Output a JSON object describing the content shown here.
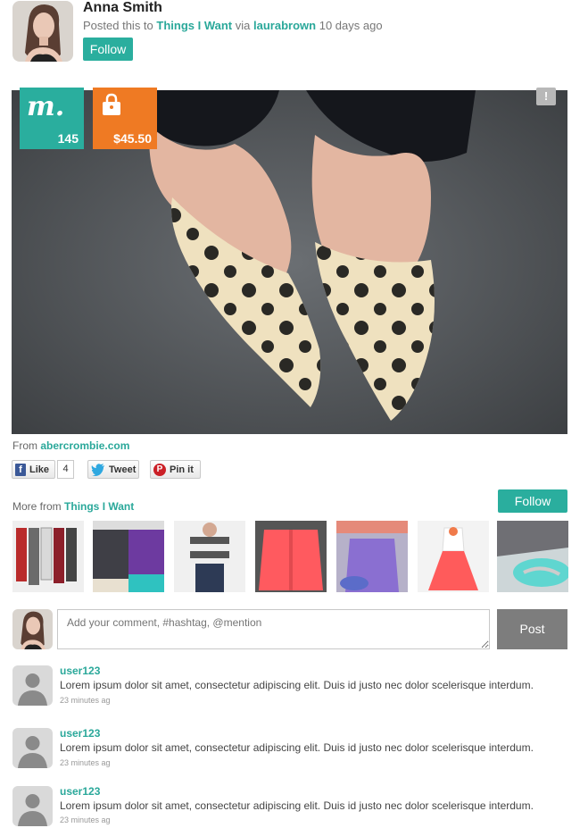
{
  "header": {
    "author_name": "Anna Smith",
    "posted_prefix": "Posted this to",
    "collection": "Things I Want",
    "via_word": "via",
    "via_user": "laurabrown",
    "time_ago": "10 days ago",
    "follow_label": "Follow"
  },
  "photo": {
    "badge_m_glyph": "m.",
    "badge_m_count": "145",
    "badge_price": "$45.50",
    "report_glyph": "!",
    "icon_names": [
      "m-logo-icon",
      "shopping-bag-icon",
      "report-flag-icon"
    ]
  },
  "source": {
    "from_label": "From",
    "domain": "abercrombie.com"
  },
  "share": {
    "like_label": "Like",
    "like_count": "4",
    "tweet_label": "Tweet",
    "pin_label": "Pin it",
    "fb_glyph": "f",
    "tw_glyph": "🐦",
    "pin_glyph": "P"
  },
  "more": {
    "prefix": "More from",
    "collection": "Things I Want",
    "follow_label": "Follow"
  },
  "composer": {
    "placeholder": "Add your comment, #hashtag, @mention",
    "post_label": "Post"
  },
  "comments": [
    {
      "user": "user123",
      "text": "Lorem ipsum dolor sit amet, consectetur adipiscing elit. Duis id justo nec dolor scelerisque interdum.",
      "time": "23 minutes ag"
    },
    {
      "user": "user123",
      "text": "Lorem ipsum dolor sit amet, consectetur adipiscing elit. Duis id justo nec dolor scelerisque interdum.",
      "time": "23 minutes ag"
    },
    {
      "user": "user123",
      "text": "Lorem ipsum dolor sit amet, consectetur adipiscing elit. Duis id justo nec dolor scelerisque interdum.",
      "time": "23 minutes ag"
    }
  ],
  "colors": {
    "accent": "#2aae9e",
    "price_badge": "#ef7a23",
    "post_button": "#7d7d7d"
  }
}
